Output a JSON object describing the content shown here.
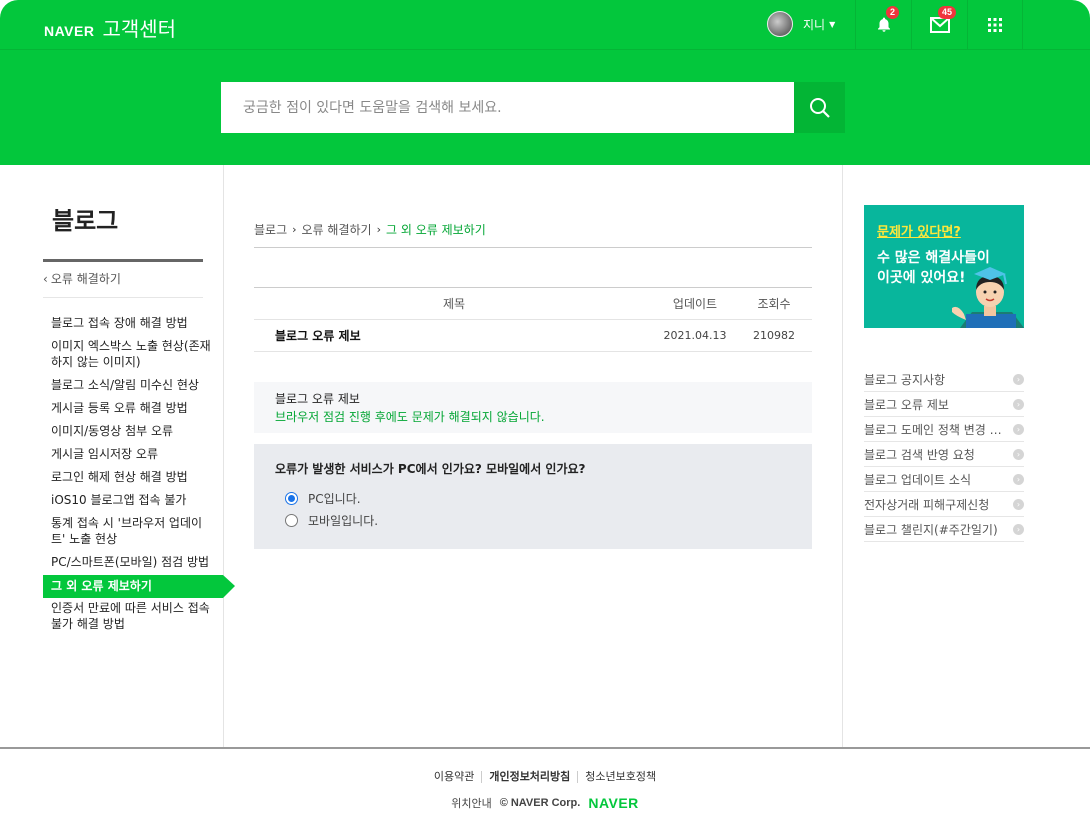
{
  "header": {
    "brand": "NAVER",
    "title": "고객센터",
    "user_name": "지니",
    "notifications_count": "2",
    "mail_count": "45",
    "search_placeholder": "궁금한 점이 있다면 도움말을 검색해 보세요."
  },
  "sidebar": {
    "title": "블로그",
    "back_label": "오류 해결하기",
    "items": [
      {
        "label": "블로그 접속 장애 해결 방법"
      },
      {
        "label": "이미지 엑스박스 노출 현상(존재하지 않는 이미지)"
      },
      {
        "label": "블로그 소식/알림 미수신 현상"
      },
      {
        "label": "게시글 등록 오류 해결 방법"
      },
      {
        "label": "이미지/동영상 첨부 오류"
      },
      {
        "label": "게시글 임시저장 오류"
      },
      {
        "label": "로그인 해제 현상 해결 방법"
      },
      {
        "label": "iOS10 블로그앱 접속 불가"
      },
      {
        "label": "통계 접속 시 '브라우저 업데이트' 노출 현상"
      },
      {
        "label": "PC/스마트폰(모바일) 점검 방법"
      },
      {
        "label": "그 외 오류 제보하기",
        "active": true
      },
      {
        "label": "인증서 만료에 따른 서비스 접속 불가 해결 방법"
      }
    ]
  },
  "breadcrumb": [
    "블로그",
    "오류 해결하기",
    "그 외 오류 제보하기"
  ],
  "table": {
    "headers": [
      "제목",
      "업데이트",
      "조회수"
    ],
    "rows": [
      {
        "title": "블로그 오류 제보",
        "date": "2021.04.13",
        "views": "210982"
      }
    ]
  },
  "notice": {
    "title": "블로그 오류 제보",
    "desc": "브라우저 점검 진행 후에도 문제가 해결되지 않습니다."
  },
  "question": {
    "text": "오류가 발생한 서비스가 PC에서 인가요? 모바일에서 인가요?",
    "options": [
      {
        "label": "PC입니다.",
        "selected": true
      },
      {
        "label": "모바일입니다.",
        "selected": false
      }
    ]
  },
  "banner": {
    "line1": "문제가 있다면?",
    "line2": "수 많은 해결사들이",
    "line3": "이곳에 있어요!"
  },
  "right_links": [
    "블로그 공지사항",
    "블로그 오류 제보",
    "블로그 도메인 정책 변경 안내",
    "블로그 검색 반영 요청",
    "블로그 업데이트 소식",
    "전자상거래 피해구제신청",
    "블로그 챌린지(#주간일기)"
  ],
  "footer": {
    "links": [
      "이용약관",
      "개인정보처리방침",
      "청소년보호정책"
    ],
    "location": "위치안내",
    "copyright": "© NAVER Corp.",
    "logo": "NAVER"
  },
  "colors": {
    "brand_green": "#03c73c",
    "accent_text_green": "#03a634",
    "badge_red": "#f0353c"
  }
}
